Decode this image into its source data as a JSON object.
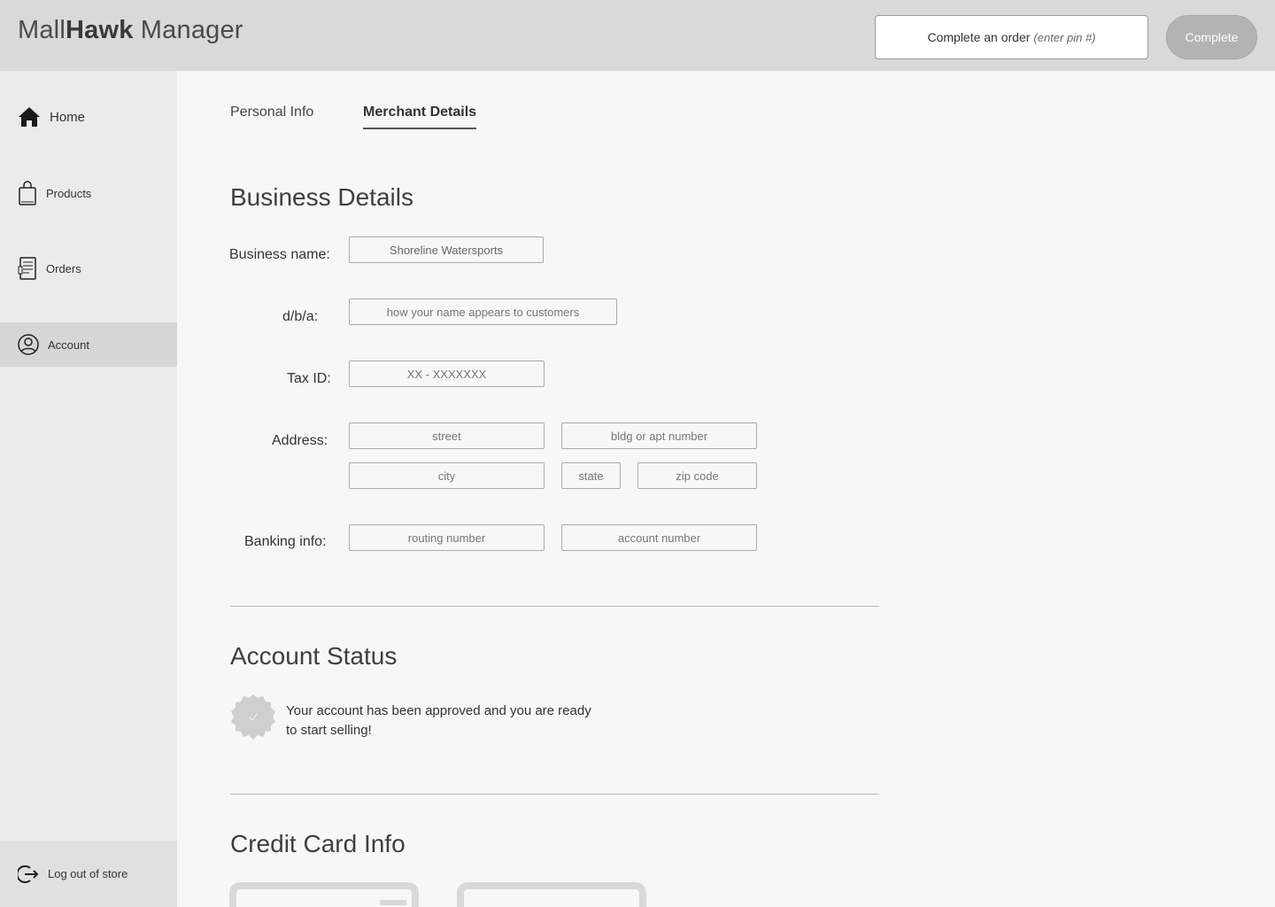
{
  "header": {
    "logo_regular": "Mall",
    "logo_bold": "Hawk",
    "logo_suffix": " Manager",
    "pin_label": "Complete an order",
    "pin_hint": "(enter pin #)",
    "complete_label": "Complete"
  },
  "sidebar": {
    "items": [
      {
        "label": "Home",
        "icon": "home-icon"
      },
      {
        "label": "Products",
        "icon": "shopping-bag-icon"
      },
      {
        "label": "Orders",
        "icon": "receipt-icon"
      },
      {
        "label": "Account",
        "icon": "user-circle-icon"
      }
    ],
    "logout_label": "Log out of store"
  },
  "tabs": [
    {
      "label": "Personal Info",
      "active": false
    },
    {
      "label": "Merchant Details",
      "active": true
    }
  ],
  "business": {
    "title": "Business Details",
    "name_label": "Business name:",
    "name_value": "Shoreline Watersports",
    "dba_label": "d/b/a:",
    "dba_placeholder": "how your name appears to customers",
    "tax_label": "Tax ID:",
    "tax_placeholder": "XX - XXXXXXX",
    "address_label": "Address:",
    "street_placeholder": "street",
    "bldg_placeholder": "bldg or apt number",
    "city_placeholder": "city",
    "state_placeholder": "state",
    "zip_placeholder": "zip code",
    "banking_label": "Banking info:",
    "routing_placeholder": "routing number",
    "account_placeholder": "account number"
  },
  "status": {
    "title": "Account Status",
    "message": "Your account has been approved and you are ready to start selling!",
    "badge_icon": "check-badge-icon"
  },
  "credit_card": {
    "title": "Credit Card Info"
  },
  "colors": {
    "header_bg": "#d9d9d9",
    "sidebar_bg": "#ebebeb",
    "active_nav_bg": "#d6d6d6",
    "main_bg": "#f7f7f7",
    "complete_btn": "#b3b3b3"
  }
}
